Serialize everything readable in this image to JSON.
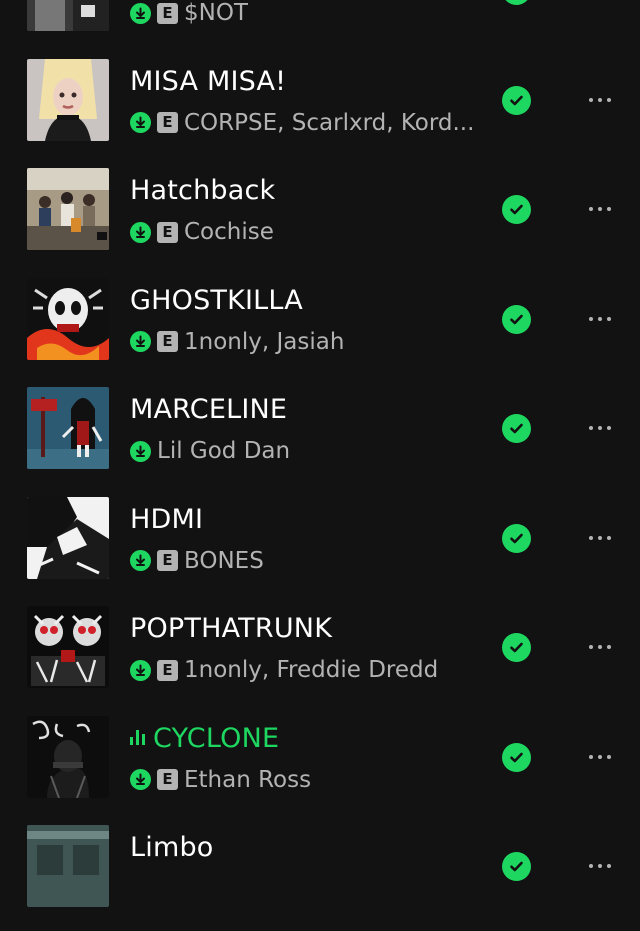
{
  "colors": {
    "accent": "#1ed760",
    "background": "#121212",
    "subtext": "#b3b3b3"
  },
  "explicit_badge": "E",
  "tracks": [
    {
      "title": "",
      "artists": "$NOT",
      "explicit": true,
      "downloaded": true,
      "saved": true,
      "playing": false
    },
    {
      "title": "MISA MISA!",
      "artists": "CORPSE, Scarlxrd, Kord...",
      "explicit": true,
      "downloaded": true,
      "saved": true,
      "playing": false
    },
    {
      "title": "Hatchback",
      "artists": "Cochise",
      "explicit": true,
      "downloaded": true,
      "saved": true,
      "playing": false
    },
    {
      "title": "GHOSTKILLA",
      "artists": "1nonly, Jasiah",
      "explicit": true,
      "downloaded": true,
      "saved": true,
      "playing": false
    },
    {
      "title": "MARCELINE",
      "artists": "Lil God Dan",
      "explicit": false,
      "downloaded": true,
      "saved": true,
      "playing": false
    },
    {
      "title": "HDMI",
      "artists": "BONES",
      "explicit": true,
      "downloaded": true,
      "saved": true,
      "playing": false
    },
    {
      "title": "POPTHATRUNK",
      "artists": "1nonly, Freddie Dredd",
      "explicit": true,
      "downloaded": true,
      "saved": true,
      "playing": false
    },
    {
      "title": "CYCLONE",
      "artists": "Ethan Ross",
      "explicit": true,
      "downloaded": true,
      "saved": true,
      "playing": true
    },
    {
      "title": "Limbo",
      "artists": "",
      "explicit": false,
      "downloaded": false,
      "saved": true,
      "playing": false
    }
  ]
}
